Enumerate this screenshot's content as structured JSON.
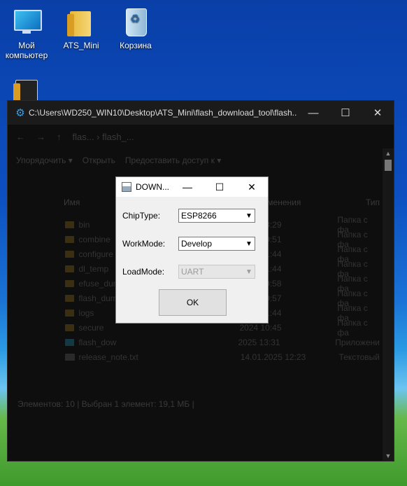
{
  "desktop": {
    "icons": [
      {
        "label": "Мой компьютер"
      },
      {
        "label": "ATS_Mini"
      },
      {
        "label": "Корзина"
      }
    ]
  },
  "explorer": {
    "title": "C:\\Users\\WD250_WIN10\\Desktop\\ATS_Mini\\flash_download_tool\\flash...",
    "nav_path": "flas... › flash_...",
    "toolbar": [
      "Упорядочить ▾",
      "Открыть",
      "Предоставить доступ к ▾"
    ],
    "columns": {
      "name": "Имя",
      "date": "менения",
      "type": "Тип"
    },
    "files": [
      {
        "name": "bin",
        "date": "2024 13:29",
        "type": "Папка с фа"
      },
      {
        "name": "combine",
        "date": "2024 10:51",
        "type": "Папка с фа"
      },
      {
        "name": "configure",
        "date": "2025 21:44",
        "type": "Папка с фа"
      },
      {
        "name": "dl_temp",
        "date": "2025 21:44",
        "type": "Папка с фа"
      },
      {
        "name": "efuse_dum",
        "date": "2024 10:58",
        "type": "Папка с фа"
      },
      {
        "name": "flash_dum",
        "date": "2024 10:57",
        "type": "Папка с фа"
      },
      {
        "name": "logs",
        "date": "2025 21:44",
        "type": "Папка с фа"
      },
      {
        "name": "secure",
        "date": "2024 10:45",
        "type": "Папка с фа"
      },
      {
        "name": "flash_dow",
        "date": "2025 13:31",
        "type": "Приложени"
      },
      {
        "name": "release_note.txt",
        "date": "14.01.2025 12:23",
        "type": "Текстовый"
      }
    ],
    "status": "Элементов: 10  |  Выбран 1 элемент: 19,1 МБ  |"
  },
  "dialog": {
    "title": "DOWN...",
    "chiptype_label": "ChipType:",
    "chiptype_value": "ESP8266",
    "workmode_label": "WorkMode:",
    "workmode_value": "Develop",
    "loadmode_label": "LoadMode:",
    "loadmode_value": "UART",
    "ok_label": "OK"
  }
}
